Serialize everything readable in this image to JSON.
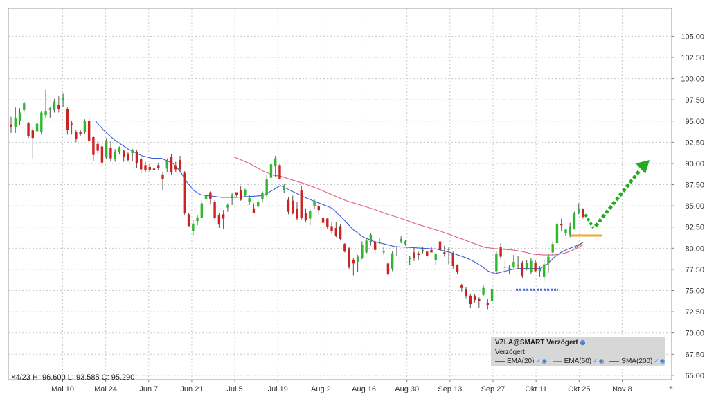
{
  "chart_data": {
    "type": "candlestick",
    "symbol_line": "VZLA@SMART Verzögert",
    "status_line": "Verzögert",
    "ylim": [
      64.5,
      108.3
    ],
    "y_ticks": [
      "105.00",
      "102.50",
      "100.00",
      "97.50",
      "95.00",
      "92.50",
      "90.00",
      "87.50",
      "85.00",
      "82.50",
      "80.00",
      "77.50",
      "75.00",
      "72.50",
      "70.00",
      "67.50",
      "65.00"
    ],
    "x_ticks": [
      "Mai 10",
      "Mai 24",
      "Jun 7",
      "Jun 21",
      "Jul 5",
      "Jul 19",
      "Aug 2",
      "Aug 16",
      "Aug 30",
      "Sep 13",
      "Sep 27",
      "Okt 11",
      "Okt 25",
      "Nov 8"
    ],
    "ohlc_readout": {
      "date": "4/23",
      "h_label": "H:",
      "h": "96.600",
      "l_label": "L:",
      "l": "93.585",
      "c_label": "C:",
      "c": "95.290"
    },
    "legend": [
      {
        "label": "EMA(20)",
        "color": "#3a5bd8"
      },
      {
        "label": "EMA(50)",
        "color": "#e0607a"
      },
      {
        "label": "SMA(200)",
        "color": "#666666"
      }
    ],
    "colors": {
      "up": "#2eb82e",
      "down": "#cc2222",
      "grid": "#c8c8c8",
      "support": "#4466ee",
      "resistance": "#f5a623",
      "forecast": "#22aa22"
    },
    "candles": [
      {
        "o": 94.6,
        "h": 95.5,
        "l": 93.6,
        "c": 94.3
      },
      {
        "o": 94.3,
        "h": 96.6,
        "l": 93.6,
        "c": 95.3
      },
      {
        "o": 95.0,
        "h": 96.5,
        "l": 94.5,
        "c": 96.0
      },
      {
        "o": 96.3,
        "h": 97.3,
        "l": 96.0,
        "c": 97.1
      },
      {
        "o": 94.8,
        "h": 94.9,
        "l": 93.0,
        "c": 93.2
      },
      {
        "o": 93.9,
        "h": 94.2,
        "l": 90.6,
        "c": 93.0
      },
      {
        "o": 93.8,
        "h": 95.3,
        "l": 93.4,
        "c": 94.7
      },
      {
        "o": 93.7,
        "h": 96.2,
        "l": 93.4,
        "c": 96.0
      },
      {
        "o": 95.7,
        "h": 98.7,
        "l": 95.3,
        "c": 96.2
      },
      {
        "o": 96.3,
        "h": 96.7,
        "l": 95.4,
        "c": 96.5
      },
      {
        "o": 96.3,
        "h": 97.6,
        "l": 96.0,
        "c": 97.3
      },
      {
        "o": 96.9,
        "h": 97.9,
        "l": 96.0,
        "c": 96.4
      },
      {
        "o": 97.4,
        "h": 98.3,
        "l": 96.7,
        "c": 97.8
      },
      {
        "o": 96.4,
        "h": 96.6,
        "l": 93.4,
        "c": 94.0
      },
      {
        "o": 94.7,
        "h": 95.0,
        "l": 93.4,
        "c": 94.6
      },
      {
        "o": 93.7,
        "h": 93.9,
        "l": 92.5,
        "c": 92.9
      },
      {
        "o": 93.7,
        "h": 94.0,
        "l": 93.2,
        "c": 93.5
      },
      {
        "o": 93.7,
        "h": 95.2,
        "l": 93.5,
        "c": 95.0
      },
      {
        "o": 95.0,
        "h": 95.5,
        "l": 92.6,
        "c": 92.7
      },
      {
        "o": 93.1,
        "h": 93.2,
        "l": 90.3,
        "c": 91.0
      },
      {
        "o": 92.3,
        "h": 92.6,
        "l": 91.2,
        "c": 91.5
      },
      {
        "o": 92.0,
        "h": 92.4,
        "l": 89.6,
        "c": 90.1
      },
      {
        "o": 90.8,
        "h": 93.0,
        "l": 90.5,
        "c": 92.7
      },
      {
        "o": 91.8,
        "h": 92.6,
        "l": 90.2,
        "c": 90.6
      },
      {
        "o": 90.5,
        "h": 91.7,
        "l": 90.2,
        "c": 91.4
      },
      {
        "o": 91.3,
        "h": 92.0,
        "l": 91.1,
        "c": 91.9
      },
      {
        "o": 91.5,
        "h": 91.6,
        "l": 90.2,
        "c": 90.8
      },
      {
        "o": 91.1,
        "h": 91.3,
        "l": 90.2,
        "c": 90.4
      },
      {
        "o": 91.2,
        "h": 91.7,
        "l": 90.3,
        "c": 91.6
      },
      {
        "o": 91.4,
        "h": 91.6,
        "l": 89.5,
        "c": 90.0
      },
      {
        "o": 90.5,
        "h": 90.8,
        "l": 88.8,
        "c": 89.3
      },
      {
        "o": 89.8,
        "h": 90.2,
        "l": 88.9,
        "c": 89.2
      },
      {
        "o": 89.6,
        "h": 90.0,
        "l": 89.0,
        "c": 89.2
      },
      {
        "o": 89.4,
        "h": 90.0,
        "l": 89.0,
        "c": 89.2
      },
      {
        "o": 89.8,
        "h": 90.0,
        "l": 89.2,
        "c": 89.5
      },
      {
        "o": 88.7,
        "h": 89.0,
        "l": 86.8,
        "c": 88.2
      },
      {
        "o": 89.4,
        "h": 90.6,
        "l": 89.0,
        "c": 90.3
      },
      {
        "o": 90.8,
        "h": 91.1,
        "l": 88.6,
        "c": 89.0
      },
      {
        "o": 89.7,
        "h": 90.2,
        "l": 89.0,
        "c": 89.3
      },
      {
        "o": 90.4,
        "h": 90.9,
        "l": 88.9,
        "c": 89.3
      },
      {
        "o": 88.9,
        "h": 89.1,
        "l": 83.9,
        "c": 84.1
      },
      {
        "o": 84.0,
        "h": 84.2,
        "l": 82.9,
        "c": 82.6
      },
      {
        "o": 82.0,
        "h": 83.3,
        "l": 81.4,
        "c": 82.9
      },
      {
        "o": 83.2,
        "h": 83.9,
        "l": 82.7,
        "c": 83.6
      },
      {
        "o": 83.6,
        "h": 85.7,
        "l": 83.6,
        "c": 85.3
      },
      {
        "o": 85.8,
        "h": 86.5,
        "l": 85.7,
        "c": 86.2
      },
      {
        "o": 86.6,
        "h": 86.7,
        "l": 85.2,
        "c": 85.8
      },
      {
        "o": 85.5,
        "h": 85.7,
        "l": 83.4,
        "c": 83.6
      },
      {
        "o": 83.9,
        "h": 84.2,
        "l": 82.4,
        "c": 82.8
      },
      {
        "o": 84.0,
        "h": 84.5,
        "l": 82.3,
        "c": 83.5
      },
      {
        "o": 84.8,
        "h": 85.3,
        "l": 84.3,
        "c": 85.1
      },
      {
        "o": 85.9,
        "h": 86.5,
        "l": 85.1,
        "c": 86.2
      },
      {
        "o": 86.6,
        "h": 86.6,
        "l": 86.1,
        "c": 86.3
      },
      {
        "o": 86.8,
        "h": 87.3,
        "l": 85.6,
        "c": 85.7
      },
      {
        "o": 86.2,
        "h": 87.0,
        "l": 86.0,
        "c": 86.9
      },
      {
        "o": 85.5,
        "h": 86.3,
        "l": 85.1,
        "c": 85.9
      },
      {
        "o": 84.7,
        "h": 85.3,
        "l": 84.2,
        "c": 84.2
      },
      {
        "o": 84.9,
        "h": 85.7,
        "l": 84.8,
        "c": 85.5
      },
      {
        "o": 85.8,
        "h": 86.7,
        "l": 85.4,
        "c": 86.5
      },
      {
        "o": 86.3,
        "h": 88.6,
        "l": 86.0,
        "c": 88.1
      },
      {
        "o": 88.3,
        "h": 90.0,
        "l": 88.0,
        "c": 89.9
      },
      {
        "o": 89.7,
        "h": 90.9,
        "l": 88.4,
        "c": 90.6
      },
      {
        "o": 89.8,
        "h": 89.9,
        "l": 88.1,
        "c": 88.2
      },
      {
        "o": 86.8,
        "h": 87.6,
        "l": 86.5,
        "c": 87.3
      },
      {
        "o": 85.7,
        "h": 86.0,
        "l": 84.0,
        "c": 84.3
      },
      {
        "o": 85.6,
        "h": 86.2,
        "l": 84.0,
        "c": 84.1
      },
      {
        "o": 84.7,
        "h": 85.5,
        "l": 83.3,
        "c": 83.5
      },
      {
        "o": 86.8,
        "h": 87.4,
        "l": 83.4,
        "c": 83.6
      },
      {
        "o": 84.1,
        "h": 84.7,
        "l": 83.1,
        "c": 83.3
      },
      {
        "o": 83.5,
        "h": 84.6,
        "l": 82.7,
        "c": 84.4
      },
      {
        "o": 85.0,
        "h": 85.8,
        "l": 84.6,
        "c": 85.6
      },
      {
        "o": 85.0,
        "h": 85.2,
        "l": 83.9,
        "c": 84.5
      },
      {
        "o": 83.6,
        "h": 83.8,
        "l": 82.2,
        "c": 83.0
      },
      {
        "o": 83.5,
        "h": 83.6,
        "l": 82.3,
        "c": 82.5
      },
      {
        "o": 82.6,
        "h": 83.1,
        "l": 81.7,
        "c": 82.0
      },
      {
        "o": 82.4,
        "h": 83.1,
        "l": 81.3,
        "c": 81.5
      },
      {
        "o": 82.6,
        "h": 82.8,
        "l": 80.9,
        "c": 81.1
      },
      {
        "o": 80.5,
        "h": 80.6,
        "l": 79.5,
        "c": 79.6
      },
      {
        "o": 80.0,
        "h": 80.1,
        "l": 77.5,
        "c": 77.8
      },
      {
        "o": 78.6,
        "h": 78.8,
        "l": 76.8,
        "c": 78.2
      },
      {
        "o": 78.4,
        "h": 79.2,
        "l": 77.2,
        "c": 79.0
      },
      {
        "o": 78.8,
        "h": 80.8,
        "l": 78.7,
        "c": 80.4
      },
      {
        "o": 79.5,
        "h": 81.2,
        "l": 79.3,
        "c": 80.9
      },
      {
        "o": 80.7,
        "h": 81.8,
        "l": 80.3,
        "c": 81.6
      },
      {
        "o": 80.7,
        "h": 80.9,
        "l": 79.3,
        "c": 79.8
      },
      {
        "o": 80.7,
        "h": 81.2,
        "l": 80.5,
        "c": 80.7
      },
      {
        "o": 79.5,
        "h": 80.2,
        "l": 79.2,
        "c": 79.6
      },
      {
        "o": 78.2,
        "h": 78.4,
        "l": 76.6,
        "c": 76.9
      },
      {
        "o": 77.6,
        "h": 79.7,
        "l": 77.3,
        "c": 79.4
      },
      {
        "o": 79.7,
        "h": 80.2,
        "l": 79.1,
        "c": 79.7
      },
      {
        "o": 80.8,
        "h": 81.4,
        "l": 80.6,
        "c": 81.1
      },
      {
        "o": 80.5,
        "h": 81.0,
        "l": 80.3,
        "c": 80.8
      },
      {
        "o": 78.7,
        "h": 79.1,
        "l": 78.0,
        "c": 78.9
      },
      {
        "o": 79.5,
        "h": 80.0,
        "l": 78.5,
        "c": 78.8
      },
      {
        "o": 79.4,
        "h": 79.6,
        "l": 78.6,
        "c": 79.2
      },
      {
        "o": 79.6,
        "h": 80.1,
        "l": 79.4,
        "c": 79.8
      },
      {
        "o": 79.6,
        "h": 79.6,
        "l": 78.9,
        "c": 79.1
      },
      {
        "o": 79.8,
        "h": 80.2,
        "l": 79.5,
        "c": 79.5
      },
      {
        "o": 78.6,
        "h": 79.4,
        "l": 78.0,
        "c": 79.3
      },
      {
        "o": 80.8,
        "h": 81.0,
        "l": 79.8,
        "c": 79.8
      },
      {
        "o": 79.5,
        "h": 80.3,
        "l": 79.0,
        "c": 79.3
      },
      {
        "o": 79.8,
        "h": 80.1,
        "l": 78.1,
        "c": 79.9
      },
      {
        "o": 79.4,
        "h": 79.6,
        "l": 77.6,
        "c": 77.9
      },
      {
        "o": 78.0,
        "h": 78.1,
        "l": 77.0,
        "c": 77.2
      },
      {
        "o": 75.6,
        "h": 75.8,
        "l": 74.9,
        "c": 75.3
      },
      {
        "o": 75.2,
        "h": 75.4,
        "l": 74.1,
        "c": 74.3
      },
      {
        "o": 74.4,
        "h": 74.6,
        "l": 73.0,
        "c": 73.4
      },
      {
        "o": 74.4,
        "h": 74.6,
        "l": 73.6,
        "c": 73.9
      },
      {
        "o": 74.0,
        "h": 74.2,
        "l": 73.0,
        "c": 73.8
      },
      {
        "o": 74.5,
        "h": 75.6,
        "l": 74.3,
        "c": 75.3
      },
      {
        "o": 73.5,
        "h": 74.0,
        "l": 72.8,
        "c": 73.3
      },
      {
        "o": 73.8,
        "h": 75.4,
        "l": 73.5,
        "c": 75.2
      },
      {
        "o": 77.3,
        "h": 79.6,
        "l": 77.0,
        "c": 79.3
      },
      {
        "o": 80.1,
        "h": 80.6,
        "l": 78.7,
        "c": 79.0
      },
      {
        "o": 77.7,
        "h": 78.5,
        "l": 77.1,
        "c": 77.8
      },
      {
        "o": 77.7,
        "h": 78.0,
        "l": 76.9,
        "c": 77.7
      },
      {
        "o": 77.8,
        "h": 79.2,
        "l": 77.6,
        "c": 78.4
      },
      {
        "o": 77.9,
        "h": 79.1,
        "l": 77.5,
        "c": 78.0
      },
      {
        "o": 78.3,
        "h": 78.5,
        "l": 76.5,
        "c": 76.7
      },
      {
        "o": 77.6,
        "h": 78.6,
        "l": 77.4,
        "c": 78.3
      },
      {
        "o": 77.2,
        "h": 78.8,
        "l": 77.0,
        "c": 78.5
      },
      {
        "o": 78.3,
        "h": 78.6,
        "l": 77.2,
        "c": 77.3
      },
      {
        "o": 77.3,
        "h": 77.9,
        "l": 76.6,
        "c": 77.6
      },
      {
        "o": 76.6,
        "h": 78.6,
        "l": 76.2,
        "c": 78.1
      },
      {
        "o": 78.2,
        "h": 79.4,
        "l": 77.1,
        "c": 79.0
      },
      {
        "o": 79.5,
        "h": 80.8,
        "l": 79.2,
        "c": 80.5
      },
      {
        "o": 80.6,
        "h": 83.4,
        "l": 80.4,
        "c": 82.9
      },
      {
        "o": 82.8,
        "h": 83.5,
        "l": 82.0,
        "c": 82.7
      },
      {
        "o": 81.8,
        "h": 82.3,
        "l": 81.5,
        "c": 82.2
      },
      {
        "o": 81.6,
        "h": 83.0,
        "l": 81.3,
        "c": 82.6
      },
      {
        "o": 82.3,
        "h": 84.3,
        "l": 82.2,
        "c": 84.1
      },
      {
        "o": 84.2,
        "h": 85.3,
        "l": 84.0,
        "c": 84.7
      },
      {
        "o": 84.6,
        "h": 84.7,
        "l": 83.5,
        "c": 83.7
      }
    ],
    "ema20": [
      [
        138,
        95.0
      ],
      [
        150,
        93.9
      ],
      [
        165,
        92.8
      ],
      [
        185,
        91.7
      ],
      [
        205,
        90.9
      ],
      [
        220,
        90.6
      ],
      [
        233,
        90.6
      ],
      [
        250,
        90.0
      ],
      [
        260,
        89.1
      ],
      [
        270,
        87.8
      ],
      [
        280,
        86.8
      ],
      [
        290,
        86.3
      ],
      [
        300,
        86.2
      ],
      [
        320,
        86.0
      ],
      [
        340,
        86.0
      ],
      [
        360,
        86.1
      ],
      [
        380,
        86.2
      ],
      [
        395,
        86.9
      ],
      [
        405,
        87.4
      ],
      [
        415,
        87.0
      ],
      [
        425,
        86.6
      ],
      [
        440,
        86.0
      ],
      [
        455,
        85.5
      ],
      [
        465,
        85.2
      ],
      [
        480,
        84.7
      ],
      [
        495,
        83.5
      ],
      [
        510,
        82.2
      ],
      [
        525,
        81.3
      ],
      [
        540,
        80.8
      ],
      [
        555,
        80.5
      ],
      [
        570,
        80.2
      ],
      [
        590,
        80.1
      ],
      [
        610,
        80.0
      ],
      [
        630,
        79.9
      ],
      [
        650,
        79.5
      ],
      [
        665,
        79.1
      ],
      [
        675,
        78.8
      ],
      [
        685,
        78.4
      ],
      [
        695,
        77.9
      ],
      [
        705,
        77.3
      ],
      [
        715,
        77.0
      ],
      [
        725,
        77.2
      ],
      [
        740,
        77.5
      ],
      [
        750,
        77.6
      ],
      [
        760,
        77.6
      ],
      [
        770,
        77.6
      ],
      [
        780,
        77.6
      ],
      [
        790,
        78.1
      ],
      [
        800,
        78.9
      ],
      [
        810,
        79.5
      ],
      [
        820,
        79.9
      ],
      [
        830,
        80.2
      ],
      [
        840,
        80.6
      ]
    ],
    "ema50": [
      [
        337,
        90.8
      ],
      [
        360,
        90.0
      ],
      [
        380,
        89.1
      ],
      [
        395,
        88.6
      ],
      [
        405,
        88.5
      ],
      [
        420,
        88.1
      ],
      [
        440,
        87.6
      ],
      [
        460,
        87.0
      ],
      [
        480,
        86.3
      ],
      [
        500,
        85.6
      ],
      [
        520,
        85.1
      ],
      [
        540,
        84.6
      ],
      [
        560,
        84.0
      ],
      [
        580,
        83.5
      ],
      [
        600,
        82.9
      ],
      [
        620,
        82.4
      ],
      [
        640,
        81.9
      ],
      [
        660,
        81.3
      ],
      [
        680,
        80.7
      ],
      [
        700,
        80.1
      ],
      [
        720,
        79.9
      ],
      [
        740,
        79.8
      ],
      [
        755,
        79.6
      ],
      [
        770,
        79.3
      ],
      [
        785,
        79.2
      ],
      [
        800,
        79.2
      ],
      [
        815,
        79.4
      ],
      [
        825,
        79.7
      ],
      [
        835,
        80.1
      ],
      [
        842,
        80.4
      ]
    ],
    "sma200": [
      [
        830,
        80.0
      ],
      [
        842,
        80.7
      ]
    ],
    "support": {
      "y": 75.1,
      "x0": 745,
      "x1": 806
    },
    "resistance": {
      "y": 81.5,
      "x0": 825,
      "x1": 869
    }
  }
}
